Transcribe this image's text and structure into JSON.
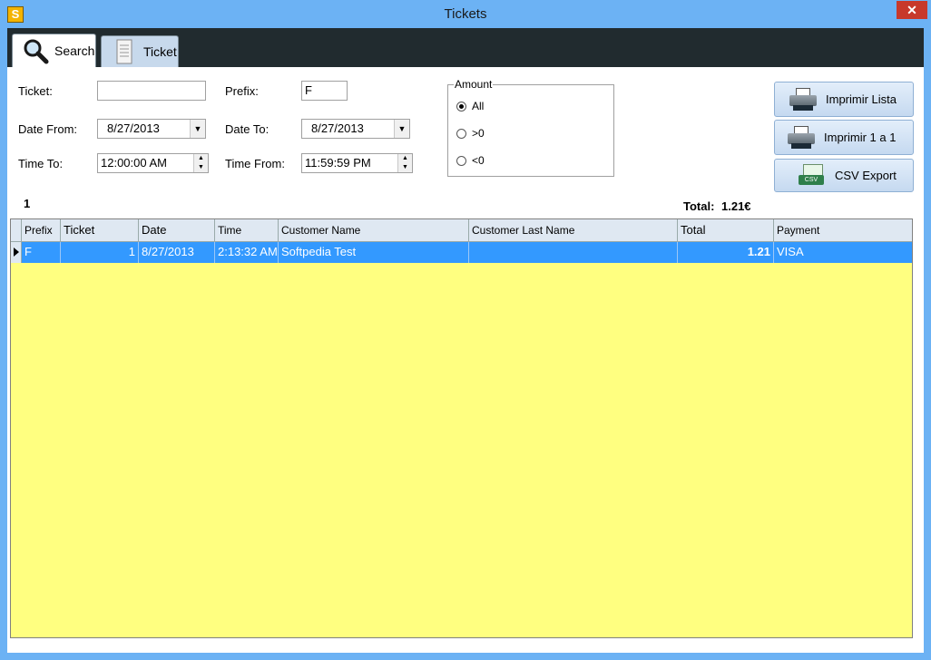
{
  "window": {
    "title": "Tickets",
    "app_icon_letter": "S",
    "close_glyph": "✕"
  },
  "tabs": [
    {
      "label": "Search",
      "icon": "magnifier-icon"
    },
    {
      "label": "Ticket",
      "icon": "ticket-icon"
    }
  ],
  "form": {
    "ticket_label": "Ticket:",
    "ticket_value": "",
    "prefix_label": "Prefix:",
    "prefix_value": "F",
    "date_from_label": "Date From:",
    "date_from_value": "8/27/2013",
    "date_to_label": "Date To:",
    "date_to_value": "8/27/2013",
    "time_to_label": "Time To:",
    "time_to_value": "12:00:00 AM",
    "time_from_label": "Time From:",
    "time_from_value": "11:59:59 PM"
  },
  "amount": {
    "title": "Amount",
    "options": [
      "All",
      ">0",
      "<0"
    ],
    "selected": "All"
  },
  "buttons": {
    "print_list": "Imprimir Lista",
    "print_one": "Imprimir 1 a 1",
    "csv_export": "CSV Export",
    "csv_tag": "CSV"
  },
  "summary": {
    "count": "1",
    "total_label": "Total:",
    "total_value": "1.21€"
  },
  "grid": {
    "columns": [
      "Prefix",
      "Ticket",
      "Date",
      "Time",
      "Customer Name",
      "Customer Last Name",
      "Total",
      "Payment"
    ],
    "rows": [
      [
        "F",
        "1",
        "8/27/2013",
        "2:13:32 AM",
        "Softpedia Test",
        "",
        "1.21",
        "VISA"
      ]
    ]
  },
  "colors": {
    "selection": "#3399ff",
    "grid_background": "#ffff80",
    "titlebar": "#6cb2f4"
  }
}
